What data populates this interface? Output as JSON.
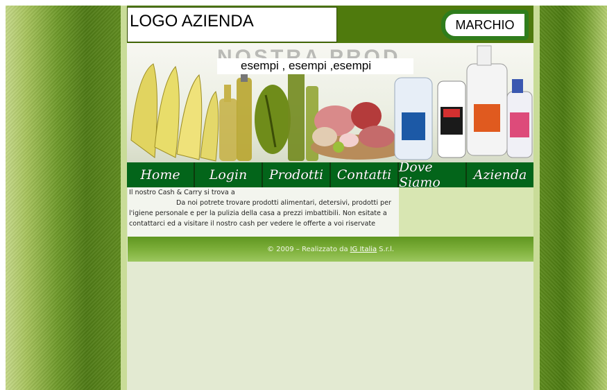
{
  "header": {
    "logo_text": "LOGO AZIENDA",
    "brand_text": "MARCHIO"
  },
  "banner": {
    "caption": "esempi , esempi ,esempi",
    "product_images": [
      "pasta",
      "olive-oil-bottles",
      "meat",
      "detergent-bottles"
    ]
  },
  "nav": {
    "items": [
      {
        "label": "Home"
      },
      {
        "label": "Login"
      },
      {
        "label": "Prodotti"
      },
      {
        "label": "Contatti"
      },
      {
        "label": "Dove Siamo"
      },
      {
        "label": "Azienda"
      }
    ]
  },
  "content": {
    "intro_first": "Il nostro Cash & Carry si trova a",
    "intro_body": "Da noi potrete trovare prodotti alimentari, detersivi, prodotti per l'igiene personale e per la pulizia della casa a prezzi imbattibili. Non esitate a contattarci ed a visitare il nostro cash per vedere le offerte a voi riservate"
  },
  "footer": {
    "copyright": "© 2009 – Realizzato da",
    "link": "IG Italia",
    "suffix": "S.r.l."
  },
  "colors": {
    "nav_bg": "#03651a",
    "header_bg": "#4f7a0d",
    "footer_bg": "#7fb13c",
    "page_bg": "#e3ead2"
  }
}
